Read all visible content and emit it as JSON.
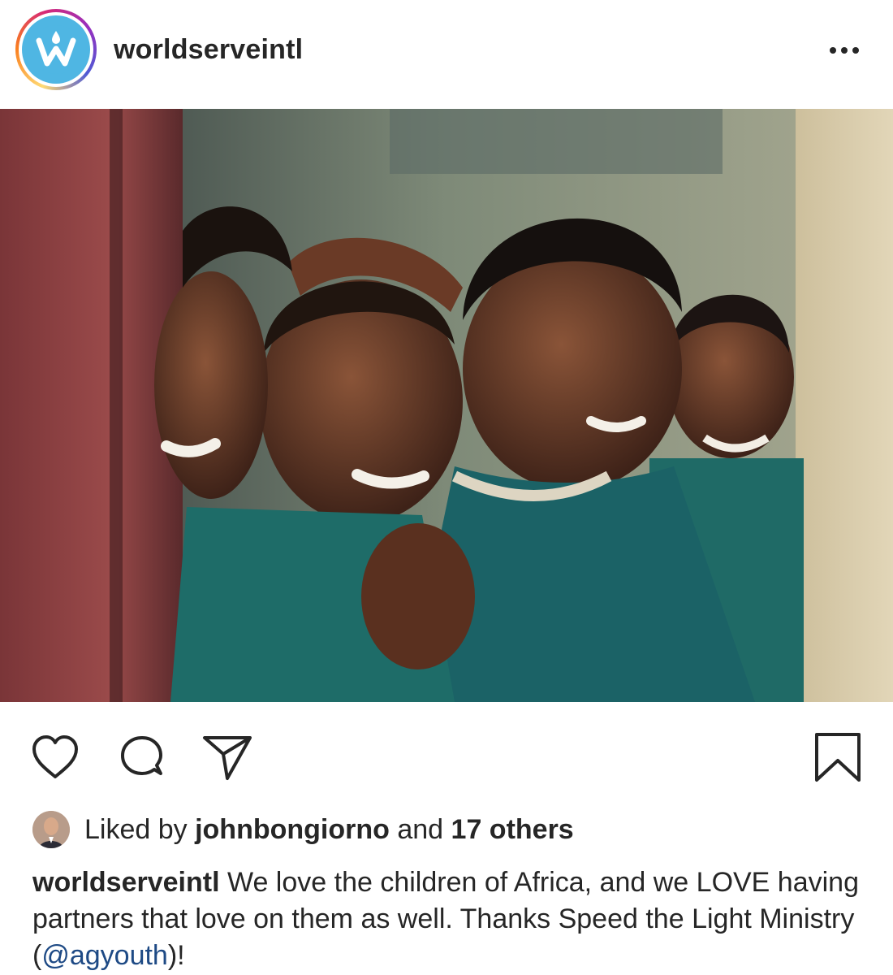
{
  "post": {
    "username": "worldserveintl",
    "avatar_icon": "worldserve-logo-icon",
    "more_icon": "more-options-icon"
  },
  "photo": {
    "icon": "post-photo"
  },
  "actions": {
    "like_icon": "heart-icon",
    "comment_icon": "comment-icon",
    "share_icon": "share-icon",
    "save_icon": "bookmark-icon"
  },
  "likes": {
    "prefix": "Liked by",
    "liker": "johnbongiorno",
    "connector": "and",
    "others": "17 others"
  },
  "caption": {
    "username": "worldserveintl",
    "text_before_mention": "We love the children of Africa, and we LOVE having partners that love on them as well. Thanks Speed the Light Ministry (",
    "mention": "@agyouth",
    "text_after_mention": ")!"
  },
  "colors": {
    "brand_blue": "#4fb6e3",
    "mention_blue": "#1e4a85",
    "text": "#262626"
  }
}
